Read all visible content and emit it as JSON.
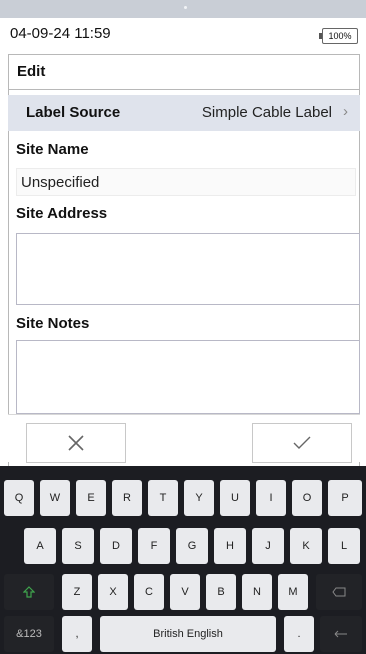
{
  "status": {
    "datetime": "04-09-24 11:59",
    "battery": "100%"
  },
  "header": {
    "title": "Edit"
  },
  "label_source": {
    "label": "Label Source",
    "value": "Simple Cable Label"
  },
  "site_name": {
    "label": "Site Name",
    "value": "Unspecified"
  },
  "site_address": {
    "label": "Site Address",
    "value": ""
  },
  "site_notes": {
    "label": "Site Notes",
    "value": ""
  },
  "actions": {
    "cancel_icon": "close-icon",
    "confirm_icon": "checkmark-icon"
  },
  "keyboard": {
    "row1": [
      "Q",
      "W",
      "E",
      "R",
      "T",
      "Y",
      "U",
      "I",
      "O",
      "P"
    ],
    "row2": [
      "A",
      "S",
      "D",
      "F",
      "G",
      "H",
      "J",
      "K",
      "L"
    ],
    "row3": [
      "Z",
      "X",
      "C",
      "V",
      "B",
      "N",
      "M"
    ],
    "symbols_key": "&123",
    "comma_key": ",",
    "space_key": "British English",
    "period_key": ".",
    "shift_icon": "shift-icon",
    "backspace_icon": "backspace-icon",
    "enter_icon": "enter-icon",
    "accent": "#3fa34d"
  }
}
